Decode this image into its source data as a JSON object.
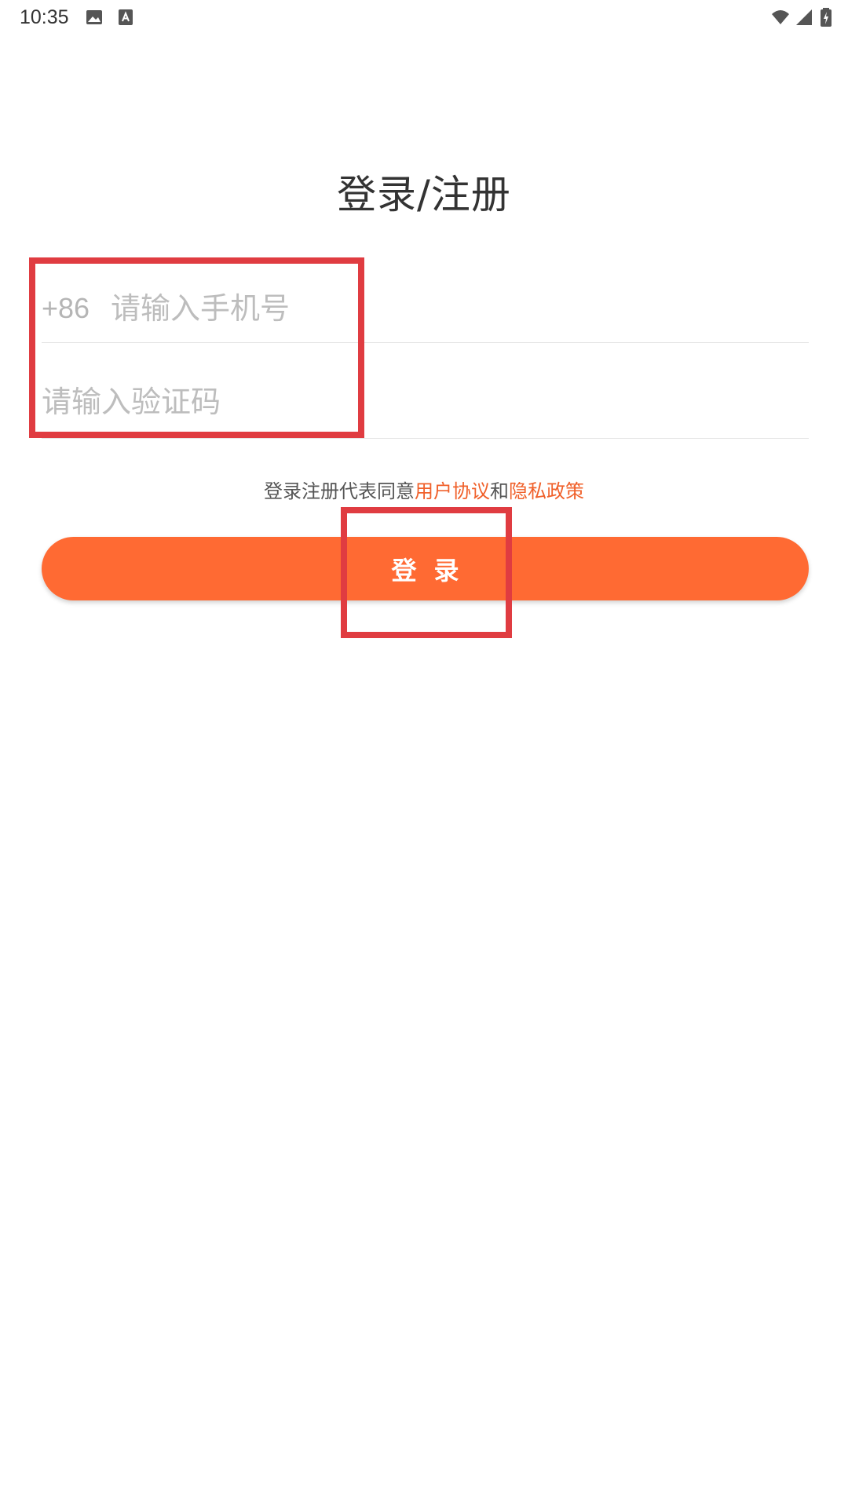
{
  "status_bar": {
    "time": "10:35",
    "icons": [
      "image-icon",
      "text-a-icon",
      "wifi-icon",
      "signal-icon",
      "battery-charging-icon"
    ]
  },
  "login": {
    "title": "登录/注册",
    "country_code": "+86",
    "phone_placeholder": "请输入手机号",
    "code_placeholder": "请输入验证码",
    "agreement_prefix": "登录注册代表同意",
    "user_agreement": "用户协议",
    "conjunction": "和",
    "privacy_policy": "隐私政策",
    "button_label": "登录"
  },
  "colors": {
    "accent": "#ff6a33",
    "link": "#f0602a",
    "highlight": "#e03c41"
  }
}
